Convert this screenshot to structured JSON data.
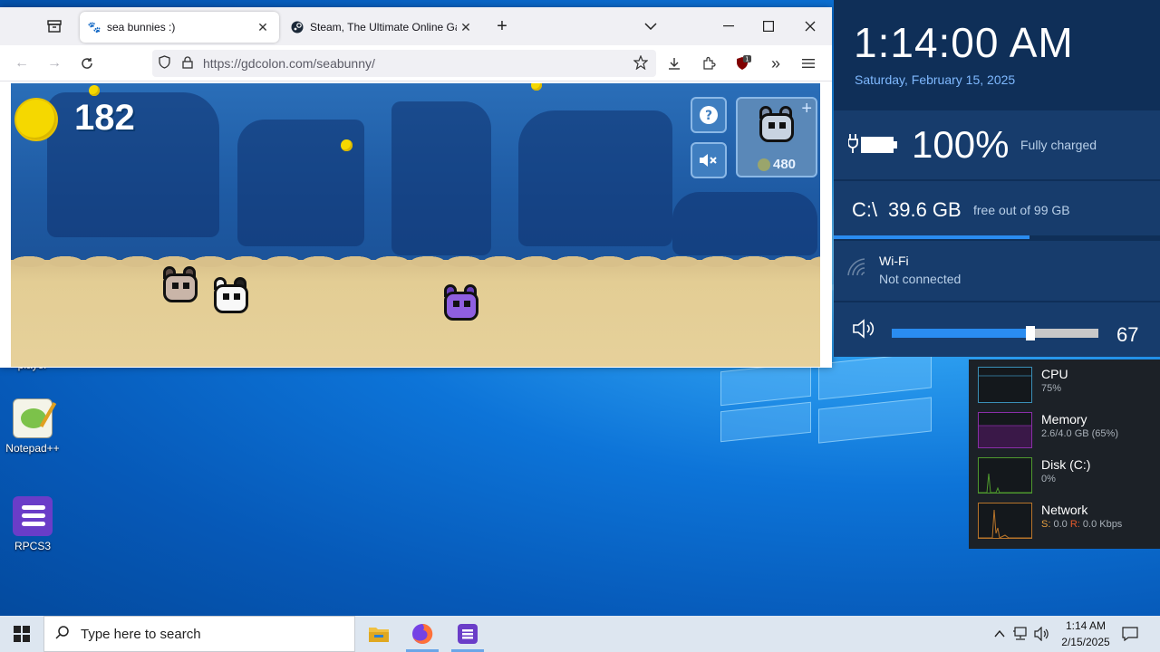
{
  "browser": {
    "tabs": [
      {
        "title": "sea bunnies :)",
        "active": true
      },
      {
        "title": "Steam, The Ultimate Online Game",
        "active": false
      }
    ],
    "url": "https://gdcolon.com/seabunny/",
    "extension_badge": "1"
  },
  "game": {
    "score": "182",
    "shop_price": "480"
  },
  "desktop": {
    "icons": [
      {
        "label": "player"
      },
      {
        "label": "Notepad++"
      },
      {
        "label": "RPCS3"
      }
    ]
  },
  "panel": {
    "time": "1:14:00 AM",
    "date": "Saturday, February 15, 2025",
    "battery_percent": "100%",
    "battery_status": "Fully charged",
    "drive_label": "C:\\",
    "drive_free": "39.6 GB",
    "drive_total": "free out of 99 GB",
    "drive_used_fraction": 0.6,
    "wifi_title": "Wi-Fi",
    "wifi_status": "Not connected",
    "volume": "67",
    "volume_fraction": 0.67
  },
  "monitor": [
    {
      "name": "CPU",
      "value": "75%",
      "color": "#3a8fb7"
    },
    {
      "name": "Memory",
      "value": "2.6/4.0 GB (65%)",
      "color": "#8a2ea8"
    },
    {
      "name": "Disk (C:)",
      "value": "0%",
      "color": "#4f9a2e"
    },
    {
      "name": "Network",
      "value_s_label": "S:",
      "value_s": "0.0",
      "value_r_label": "R:",
      "value_r": "0.0 Kbps",
      "color": "#b8742a"
    }
  ],
  "taskbar": {
    "search_placeholder": "Type here to search",
    "time": "1:14 AM",
    "date": "2/15/2025"
  },
  "colors": {
    "accent": "#2a8cf0",
    "panel_bg": "#0f2f58",
    "panel_row": "#173c6c"
  }
}
